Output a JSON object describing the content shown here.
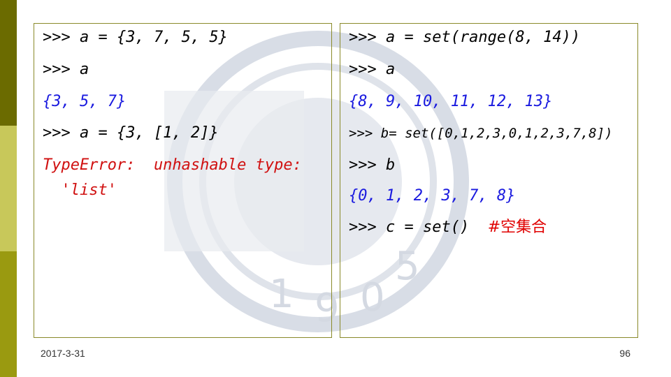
{
  "left_panel": {
    "lines": [
      ">>> a = {3, 7, 5, 5}",
      ">>> a",
      "{3, 5, 7}",
      ">>> a = {3, [1, 2]}",
      "TypeError:  unhashable type:",
      "  'list'"
    ]
  },
  "right_panel": {
    "lines": [
      ">>> a = set(range(8, 14))",
      ">>> a",
      "{8, 9, 10, 11, 12, 13}",
      ">>> b= set([0,1,2,3,0,1,2,3,7,8])",
      ">>> b",
      "{0, 1, 2, 3, 7, 8}",
      ">>> c = set()  "
    ],
    "comment": "#空集合"
  },
  "footer": {
    "date": "2017-3-31",
    "page_number": "96"
  },
  "colors": {
    "output": "#1a1adf",
    "error": "#d01010",
    "comment": "#e00000",
    "sidebar_dark": "#6b6b00",
    "sidebar_light": "#c8c85a",
    "sidebar_mid": "#9a9a10"
  }
}
